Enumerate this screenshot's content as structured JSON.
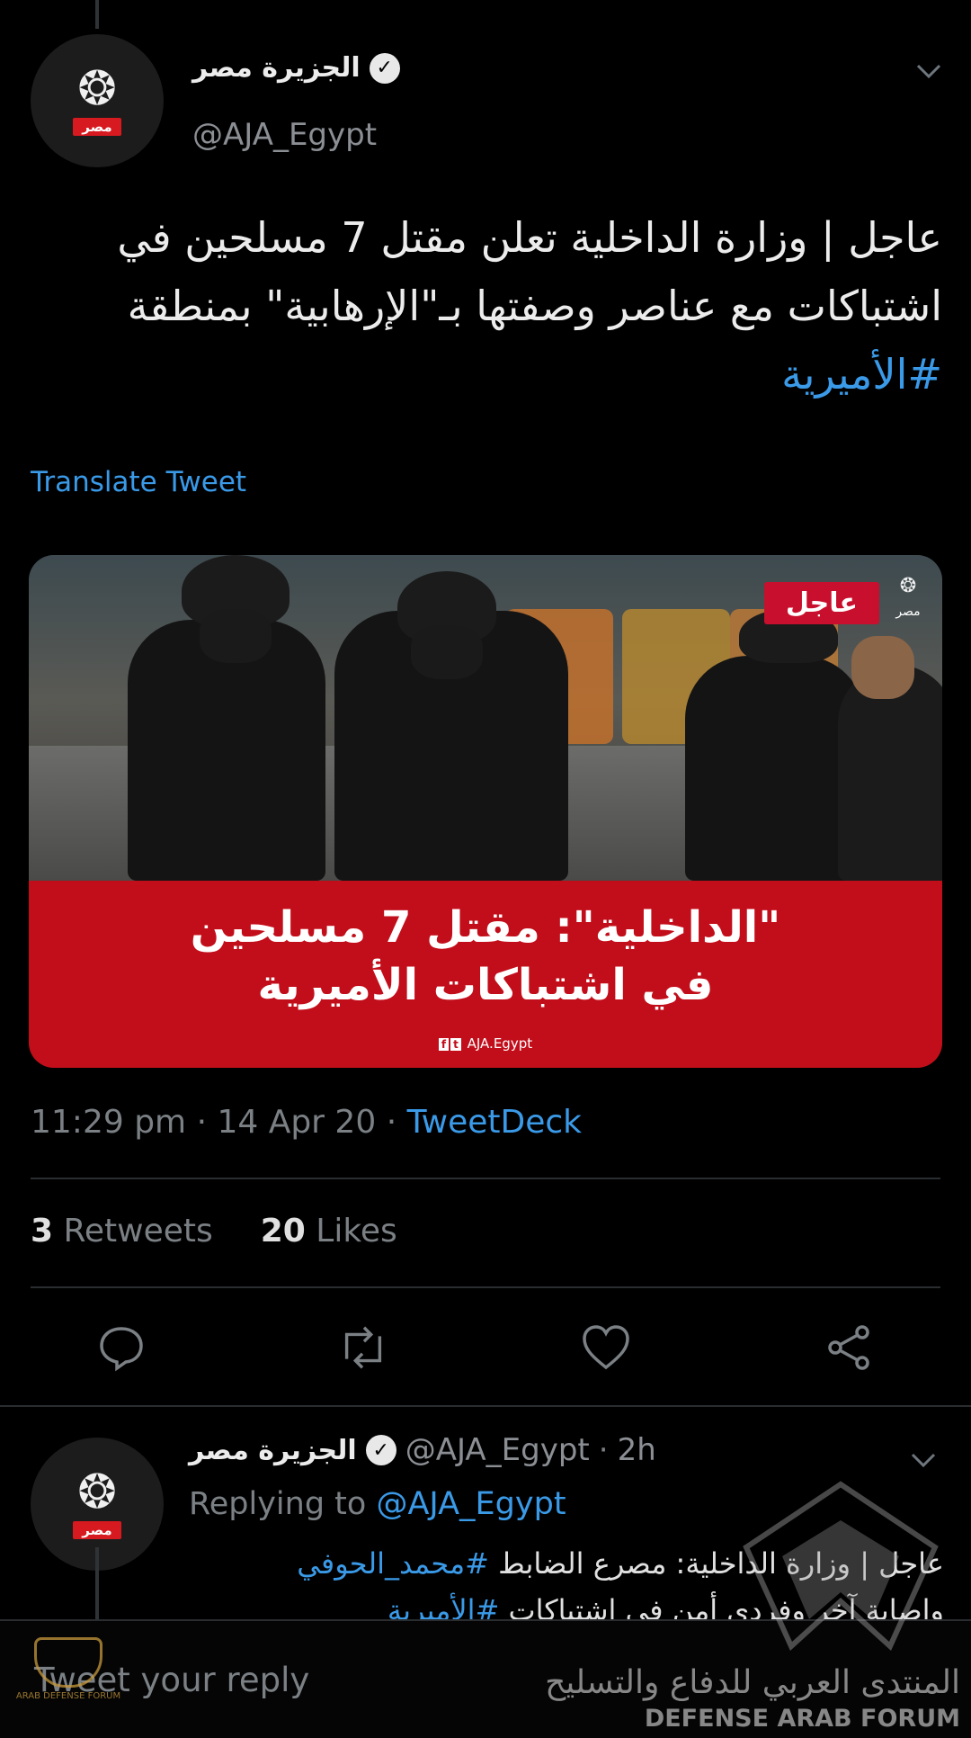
{
  "main_tweet": {
    "display_name": "الجزيرة مصر",
    "handle": "@AJA_Egypt",
    "avatar": {
      "glyph": "الجزيرة",
      "tag": "مصر"
    },
    "text_plain": "عاجل | وزارة الداخلية تعلن مقتل 7 مسلحين في اشتباكات مع عناصر وصفتها بـ\"الإرهابية\" بمنطقة ",
    "text_hashtag": "#الأميرية",
    "translate_label": "Translate Tweet",
    "media": {
      "breaking_tag": "عاجل",
      "corner_logo": "مصر",
      "headline_line1": "\"الداخلية\": مقتل 7 مسلحين",
      "headline_line2": "في اشتباكات الأميرية",
      "footer_handle": "AJA.Egypt"
    },
    "time": "11:29 pm",
    "date": "14 Apr 20",
    "source": "TweetDeck",
    "retweets_count": "3",
    "retweets_label": "Retweets",
    "likes_count": "20",
    "likes_label": "Likes",
    "actions": [
      "reply-icon",
      "retweet-icon",
      "like-icon",
      "share-icon"
    ]
  },
  "reply_tweet": {
    "display_name": "الجزيرة مصر",
    "handle": "@AJA_Egypt",
    "age": "2h",
    "replying_prefix": "Replying to",
    "replying_mention": "@AJA_Egypt",
    "text_line1_plain": "عاجل | وزارة الداخلية: مصرع الضابط ",
    "text_line1_hashtag": "#محمد_الحوفي",
    "text_line2_plain": "وإصابة آخر وفردي أمن في اشتباكات ",
    "text_line2_hashtag": "#الأميرية"
  },
  "reply_bar": {
    "placeholder": "Tweet your reply"
  },
  "watermark": {
    "left_text": "ARAB DEFENSE FORUM",
    "right_arabic": "المنتدى العربي للدفاع والتسليح",
    "right_english": "DEFENSE ARAB FORUM"
  },
  "colors": {
    "background": "#000000",
    "accent": "#3a9ae8",
    "muted": "#7b8085",
    "breaking_red": "#c20e1a"
  }
}
